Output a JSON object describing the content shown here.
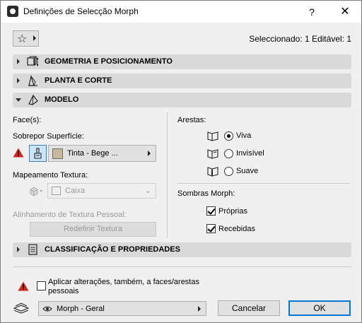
{
  "window": {
    "title": "Definições de Selecção Morph"
  },
  "titlebar": {
    "help_label": "?",
    "close_label": "✕"
  },
  "toolbar": {
    "selection_info": "Seleccionado: 1 Editável: 1"
  },
  "sections": [
    {
      "label": "GEOMETRIA E POSICIONAMENTO",
      "expanded": false
    },
    {
      "label": "PLANTA E CORTE",
      "expanded": false
    },
    {
      "label": "MODELO",
      "expanded": true
    },
    {
      "label": "CLASSIFICAÇÃO E PROPRIEDADES",
      "expanded": false
    }
  ],
  "model": {
    "faces_label": "Face(s):",
    "override_surface_label": "Sobrepor Superfície:",
    "surface_value": "Tinta - Bege ...",
    "surface_color": "#c9b99c",
    "texture_mapping_label": "Mapeamento Textura:",
    "texture_mapping_value": "Caixa",
    "custom_alignment_label": "Alinhamento de Textura Pessoal:",
    "reset_texture_label": "Redefinir Textura",
    "edges_label": "Arestas:",
    "edges_options": [
      {
        "label": "Viva",
        "selected": true
      },
      {
        "label": "Invisível",
        "selected": false
      },
      {
        "label": "Suave",
        "selected": false
      }
    ],
    "shadows_label": "Sombras Morph:",
    "shadow_options": [
      {
        "label": "Próprias",
        "checked": true
      },
      {
        "label": "Recebidas",
        "checked": true
      }
    ]
  },
  "footer": {
    "apply_label": "Aplicar alterações, também, a faces/arestas pessoais",
    "apply_checked": false,
    "favorite_value": "Morph - Geral",
    "cancel_label": "Cancelar",
    "ok_label": "OK"
  },
  "colors": {
    "warning": "#d0281c",
    "section_bar": "#d9d9d9",
    "accent": "#0078d7"
  }
}
